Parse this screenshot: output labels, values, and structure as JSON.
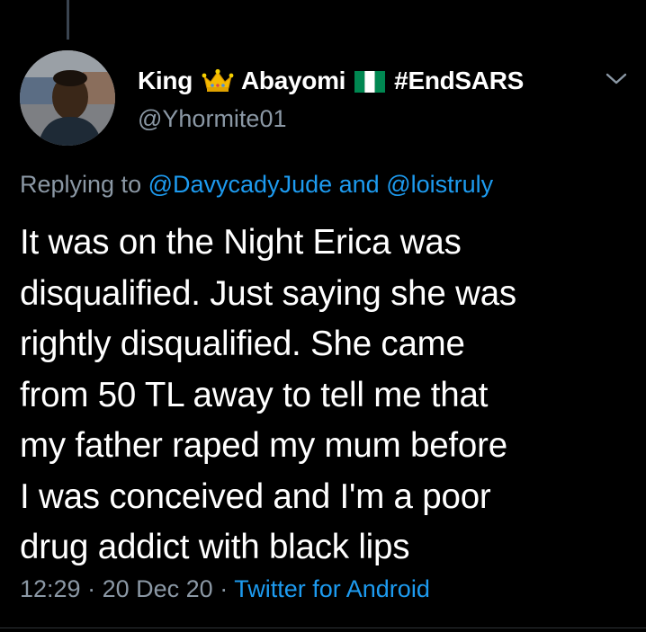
{
  "tweet": {
    "author": {
      "name_first": "King",
      "name_second": "Abayomi",
      "hashtag": "#EndSARS",
      "handle": "@Yhormite01",
      "crown_icon": "crown-emoji-icon",
      "flag_icon": "nigeria-flag-icon"
    },
    "reply": {
      "prefix": "Replying to",
      "mention_1": "@DavycadyJude",
      "connector": "and",
      "mention_2": "@loistruly"
    },
    "text": "It was on the Night Erica was\ndisqualified. Just saying she was\nrightly disqualified. She came\nfrom 50 TL away to tell me that\nmy father raped my mum before\nI was conceived and I'm a poor\ndrug addict with black lips",
    "time": "12:29",
    "separator": "·",
    "date": "20 Dec 20",
    "source": "Twitter for Android"
  },
  "colors": {
    "background": "#000000",
    "text_primary": "#ffffff",
    "text_secondary": "#8b98a5",
    "link": "#1d9bf0",
    "flag_green": "#008751"
  }
}
